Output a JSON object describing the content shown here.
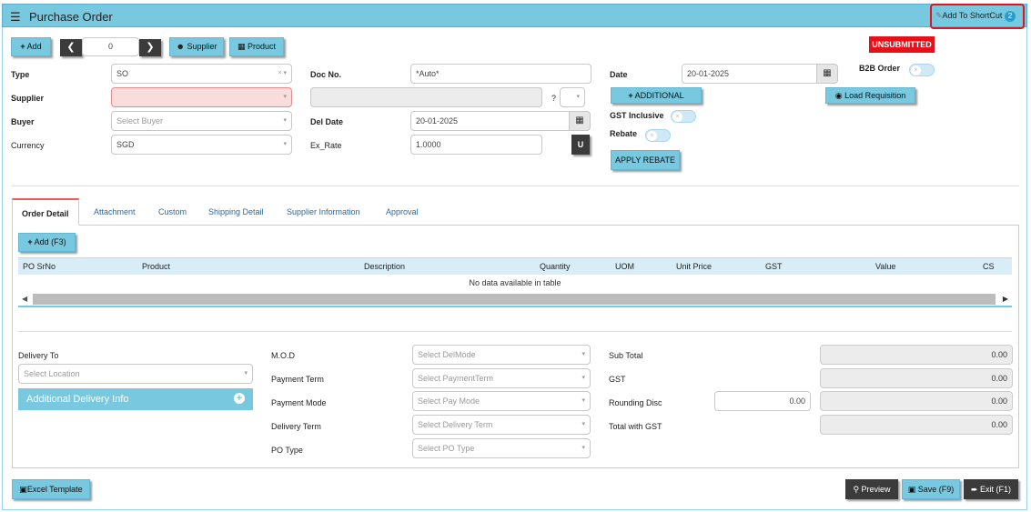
{
  "header": {
    "menu_icon": "hamburger-menu-icon",
    "title": "Purchase Order",
    "shortcut_label": "Add To ShortCut",
    "shortcut_badge": "2"
  },
  "toolbar": {
    "add_label": "Add",
    "nav_value": "0",
    "supplier_label": "Supplier",
    "product_label": "Product"
  },
  "status": {
    "label": "UNSUBMITTED",
    "color": "#e4111b"
  },
  "form": {
    "type_label": "Type",
    "type_value": "SO",
    "supplier_label": "Supplier",
    "buyer_label": "Buyer",
    "buyer_placeholder": "Select Buyer",
    "currency_label": "Currency",
    "currency_value": "SGD",
    "docno_label": "Doc No.",
    "docno_value": "*Auto*",
    "question_mark": "?",
    "deldate_label": "Del Date",
    "deldate_value": "20-01-2025",
    "exrate_label": "Ex_Rate",
    "exrate_value": "1.0000",
    "u_button": "U",
    "date_label": "Date",
    "date_value": "20-01-2025",
    "additional_button": "ADDITIONAL",
    "gst_inclusive_label": "GST Inclusive",
    "rebate_label": "Rebate",
    "apply_rebate_button": "APPLY REBATE",
    "b2b_label": "B2B Order",
    "load_requisition_button": "Load Requisition"
  },
  "tabs": [
    "Order Detail",
    "Attachment",
    "Custom",
    "Shipping Detail",
    "Supplier Information",
    "Approval"
  ],
  "order_detail": {
    "add_button": "Add (F3)",
    "columns": [
      "PO SrNo",
      "Product",
      "Description",
      "Quantity",
      "UOM",
      "Unit Price",
      "GST",
      "Value",
      "CS"
    ],
    "empty_text": "No data available in table"
  },
  "bottom": {
    "delivery_to_label": "Delivery To",
    "location_placeholder": "Select Location",
    "additional_delivery_info": "Additional Delivery Info",
    "mod_label": "M.O.D",
    "mod_placeholder": "Select DelMode",
    "payment_term_label": "Payment Term",
    "payment_term_placeholder": "Select PaymentTerm",
    "payment_mode_label": "Payment Mode",
    "payment_mode_placeholder": "Select Pay Mode",
    "delivery_term_label": "Delivery Term",
    "delivery_term_placeholder": "Select Delivery Term",
    "po_type_label": "PO Type",
    "po_type_placeholder": "Select PO Type",
    "subtotal_label": "Sub Total",
    "subtotal_value": "0.00",
    "gst_label": "GST",
    "gst_value": "0.00",
    "rounding_label": "Rounding Disc",
    "rounding_input": "0.00",
    "rounding_value": "0.00",
    "total_gst_label": "Total with GST",
    "total_gst_value": "0.00"
  },
  "footer": {
    "excel_template": "Excel Template",
    "preview": "Preview",
    "save": "Save (F9)",
    "exit": "Exit (F1)"
  }
}
